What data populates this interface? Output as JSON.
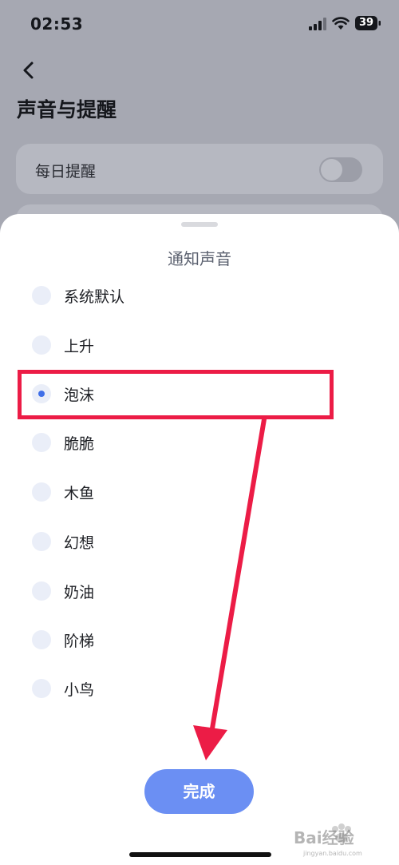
{
  "status_bar": {
    "time": "02:53",
    "battery": "39",
    "icons": [
      "signal-icon",
      "wifi-icon",
      "battery-icon"
    ]
  },
  "page": {
    "title": "声音与提醒",
    "back_icon": "back-chevron-icon",
    "settings": [
      {
        "label": "每日提醒",
        "toggle_on": false
      }
    ]
  },
  "sheet": {
    "title": "通知声音",
    "options": [
      {
        "label": "系统默认",
        "selected": false
      },
      {
        "label": "上升",
        "selected": false
      },
      {
        "label": "泡沫",
        "selected": true
      },
      {
        "label": "脆脆",
        "selected": false
      },
      {
        "label": "木鱼",
        "selected": false
      },
      {
        "label": "幻想",
        "selected": false
      },
      {
        "label": "奶油",
        "selected": false
      },
      {
        "label": "阶梯",
        "selected": false
      },
      {
        "label": "小鸟",
        "selected": false
      }
    ],
    "done_label": "完成"
  },
  "watermark": {
    "text": "Bai经验",
    "sub": "jingyan.baidu.com"
  },
  "colors": {
    "accent": "#6b8ff3",
    "radio_selected": "#3f6fe8",
    "annotation": "#ec1c46",
    "overlay": "#a6a8b2"
  }
}
